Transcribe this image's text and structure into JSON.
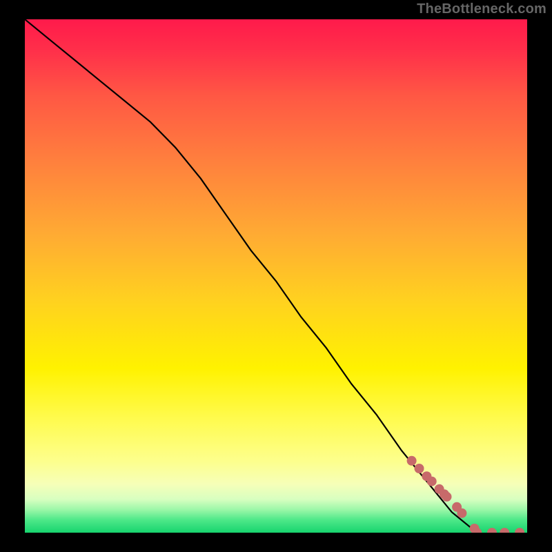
{
  "chart_data": {
    "type": "line",
    "title": "",
    "xlabel": "",
    "ylabel": "",
    "xlim": [
      0,
      100
    ],
    "ylim": [
      0,
      100
    ],
    "series": [
      {
        "name": "curve",
        "x": [
          0,
          5,
          10,
          15,
          20,
          25,
          30,
          35,
          40,
          45,
          50,
          55,
          60,
          65,
          70,
          75,
          80,
          85,
          90
        ],
        "y": [
          100,
          96,
          92,
          88,
          84,
          80,
          75,
          69,
          62,
          55,
          49,
          42,
          36,
          29,
          23,
          16,
          10,
          4,
          0
        ]
      }
    ],
    "markers": {
      "name": "highlight-points",
      "x": [
        77,
        78.5,
        80,
        81,
        82.5,
        83.5,
        84,
        86,
        87,
        89.5,
        90,
        93,
        95.5,
        98.5
      ],
      "y": [
        14,
        12.5,
        11,
        10,
        8.5,
        7.5,
        7,
        5,
        3.8,
        0.8,
        0,
        0,
        0,
        0
      ]
    },
    "background_gradient": {
      "stops": [
        {
          "offset": 0.0,
          "color": "#ff1a4b"
        },
        {
          "offset": 0.06,
          "color": "#ff2f4a"
        },
        {
          "offset": 0.15,
          "color": "#ff5844"
        },
        {
          "offset": 0.28,
          "color": "#ff813d"
        },
        {
          "offset": 0.42,
          "color": "#ffab33"
        },
        {
          "offset": 0.55,
          "color": "#ffd21f"
        },
        {
          "offset": 0.68,
          "color": "#fff200"
        },
        {
          "offset": 0.78,
          "color": "#fffb50"
        },
        {
          "offset": 0.86,
          "color": "#fdff8c"
        },
        {
          "offset": 0.905,
          "color": "#f6ffb8"
        },
        {
          "offset": 0.935,
          "color": "#d8ffc0"
        },
        {
          "offset": 0.955,
          "color": "#9cf7a8"
        },
        {
          "offset": 0.975,
          "color": "#4ee889"
        },
        {
          "offset": 1.0,
          "color": "#17d46e"
        }
      ]
    },
    "marker_color": "#c76a6a",
    "line_color": "#000000"
  },
  "watermark": "TheBottleneck.com"
}
